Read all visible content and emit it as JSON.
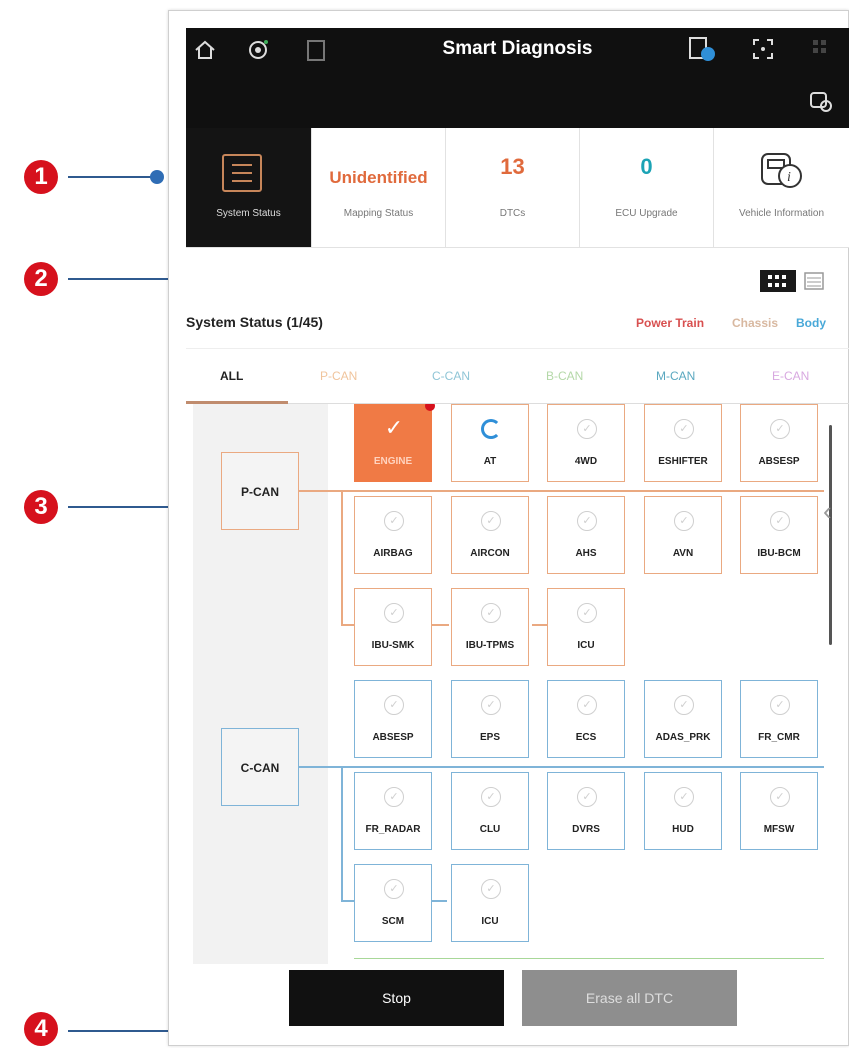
{
  "callouts": [
    {
      "num": "1"
    },
    {
      "num": "2"
    },
    {
      "num": "3"
    },
    {
      "num": "4"
    }
  ],
  "app": {
    "title": "Smart Diagnosis",
    "icons": [
      "home-icon",
      "diagnosis-gear-icon",
      "document-icon",
      "vci-info-icon",
      "expand-icon",
      "menu-icon",
      "vehicle-settings-icon"
    ]
  },
  "status": {
    "system_status_label": "System Status",
    "mapping_value": "Unidentified",
    "mapping_label": "Mapping Status",
    "dtcs_value": "13",
    "dtcs_label": "DTCs",
    "ecu_value": "0",
    "ecu_label": "ECU Upgrade",
    "vehicle_label": "Vehicle Information",
    "colors": {
      "mapping": "#e06a3c",
      "dtcs": "#e06a3c",
      "ecu": "#1ba3b5"
    }
  },
  "section": {
    "title": "System Status (1/45)",
    "legend": [
      {
        "label": "Power Train",
        "color": "#d85050"
      },
      {
        "label": "Chassis",
        "color": "#d8b8a0"
      },
      {
        "label": "Body",
        "color": "#48a8d8"
      }
    ]
  },
  "tabs": [
    {
      "label": "ALL",
      "color": "#222222"
    },
    {
      "label": "P-CAN",
      "color": "#f0c49c"
    },
    {
      "label": "C-CAN",
      "color": "#8fc5d6"
    },
    {
      "label": "B-CAN",
      "color": "#b4d8a8"
    },
    {
      "label": "M-CAN",
      "color": "#5aa8c0"
    },
    {
      "label": "E-CAN",
      "color": "#d8a8e0"
    }
  ],
  "buses": [
    {
      "name": "P-CAN",
      "color": "#eaa981",
      "ecus": [
        "ENGINE",
        "AT",
        "4WD",
        "ESHIFTER",
        "ABSESP",
        "AIRBAG",
        "AIRCON",
        "AHS",
        "AVN",
        "IBU-BCM",
        "IBU-SMK",
        "IBU-TPMS",
        "ICU"
      ],
      "active": "ENGINE",
      "loading": "AT"
    },
    {
      "name": "C-CAN",
      "color": "#7fb4d8",
      "ecus": [
        "ABSESP",
        "EPS",
        "ECS",
        "ADAS_PRK",
        "FR_CMR",
        "FR_RADAR",
        "CLU",
        "DVRS",
        "HUD",
        "MFSW",
        "SCM",
        "ICU"
      ]
    }
  ],
  "buttons": {
    "stop": "Stop",
    "erase": "Erase all DTC"
  }
}
